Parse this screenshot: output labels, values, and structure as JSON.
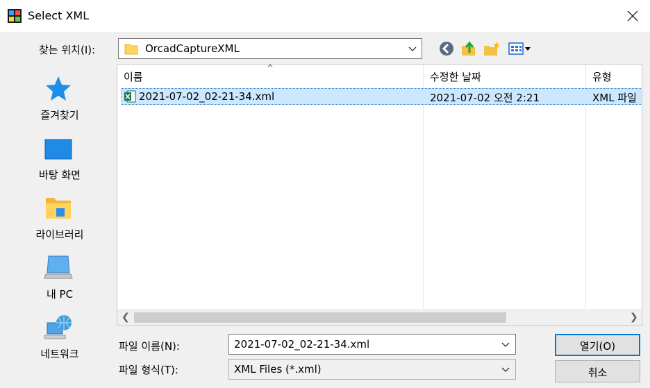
{
  "window": {
    "title": "Select XML"
  },
  "lookin": {
    "label": "찾는 위치(I):",
    "value": "OrcadCaptureXML"
  },
  "toolbar": {
    "icons": [
      "back-icon",
      "up-folder-icon",
      "new-folder-icon",
      "view-menu-icon"
    ]
  },
  "places": [
    {
      "label": "즐겨찾기",
      "icon": "favorites-star-icon"
    },
    {
      "label": "바탕 화면",
      "icon": "desktop-icon"
    },
    {
      "label": "라이브러리",
      "icon": "libraries-icon"
    },
    {
      "label": "내 PC",
      "icon": "this-pc-icon"
    },
    {
      "label": "네트워크",
      "icon": "network-icon"
    }
  ],
  "filelist": {
    "columns": [
      "이름",
      "수정한 날짜",
      "유형"
    ],
    "rows": [
      {
        "name": "2021-07-02_02-21-34.xml",
        "date": "2021-07-02 오전 2:21",
        "type": "XML 파일",
        "selected": true
      }
    ]
  },
  "filename": {
    "label": "파일 이름(N):",
    "value": "2021-07-02_02-21-34.xml"
  },
  "filetype": {
    "label": "파일 형식(T):",
    "value": "XML Files (*.xml)"
  },
  "buttons": {
    "open": "열기(O)",
    "cancel": "취소"
  },
  "colors": {
    "selection": "#cce8ff",
    "accent": "#0078d7",
    "dialog_bg": "#f0f0f0"
  }
}
